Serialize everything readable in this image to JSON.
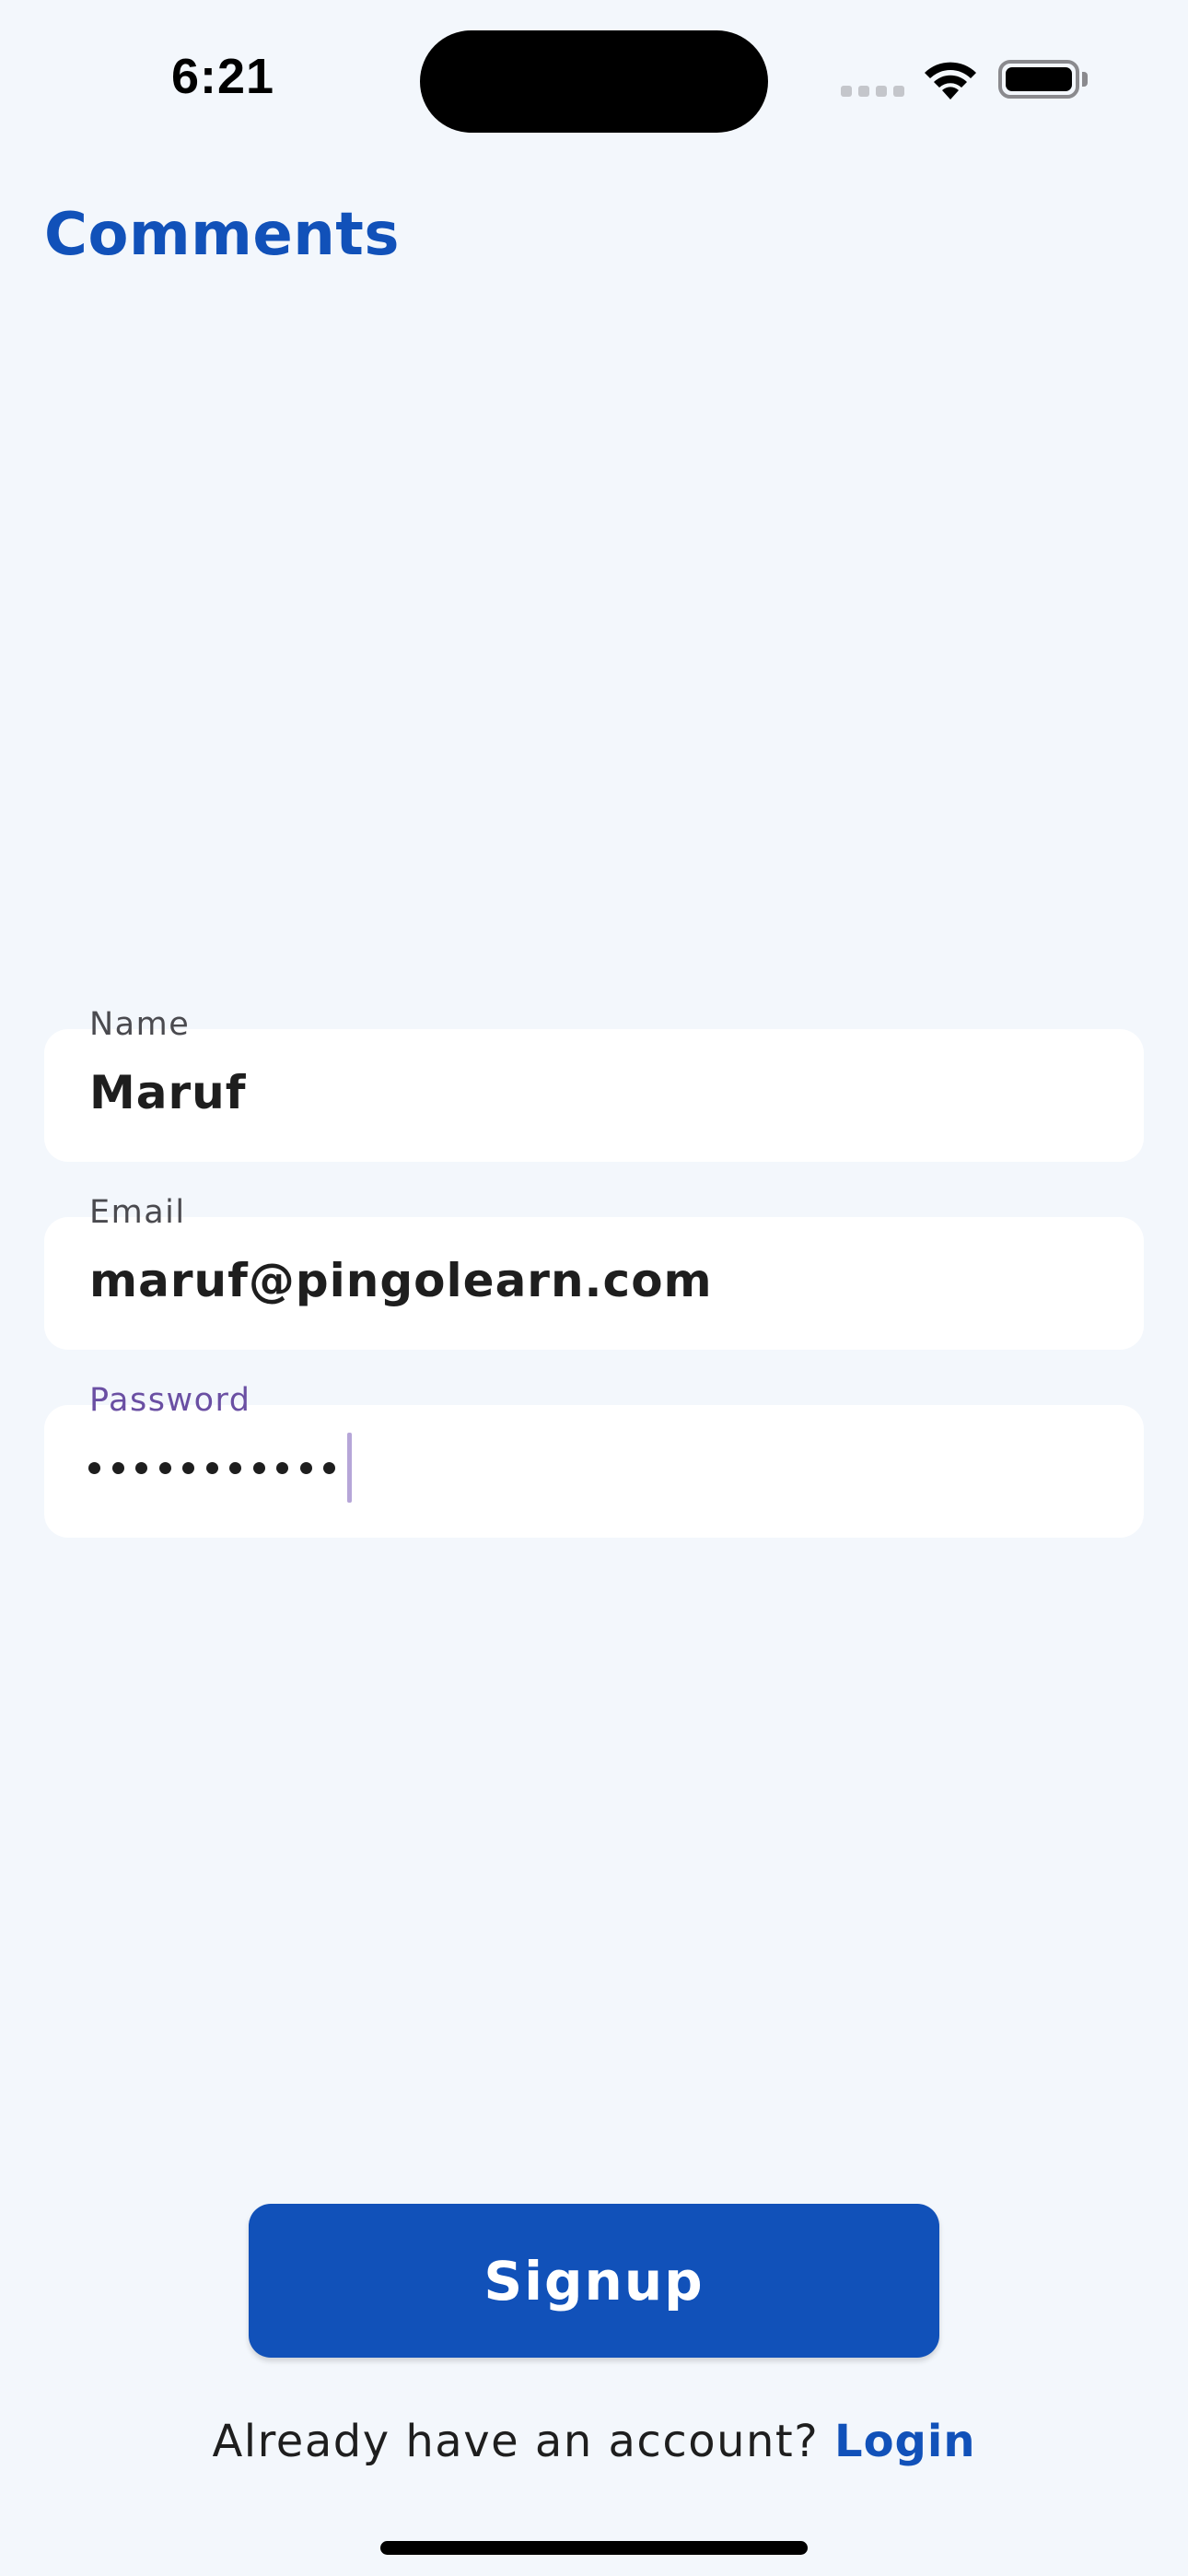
{
  "status_bar": {
    "time": "6:21",
    "icons": [
      "cellular-signal-icon",
      "wifi-icon",
      "battery-icon"
    ]
  },
  "header": {
    "title": "Comments"
  },
  "form": {
    "name": {
      "label": "Name",
      "value": "Maruf"
    },
    "email": {
      "label": "Email",
      "value": "maruf@pingolearn.com"
    },
    "password": {
      "label": "Password",
      "masked_length": 11,
      "focused": true
    }
  },
  "signup_button": {
    "label": "Signup"
  },
  "login_prompt": {
    "text": "Already have an account?",
    "link_label": "Login"
  },
  "colors": {
    "background": "#f3f7fc",
    "accent": "#1151b9",
    "focused_label": "#6a4fa3",
    "caret": "#b6a6d8",
    "field_background": "#ffffff"
  }
}
